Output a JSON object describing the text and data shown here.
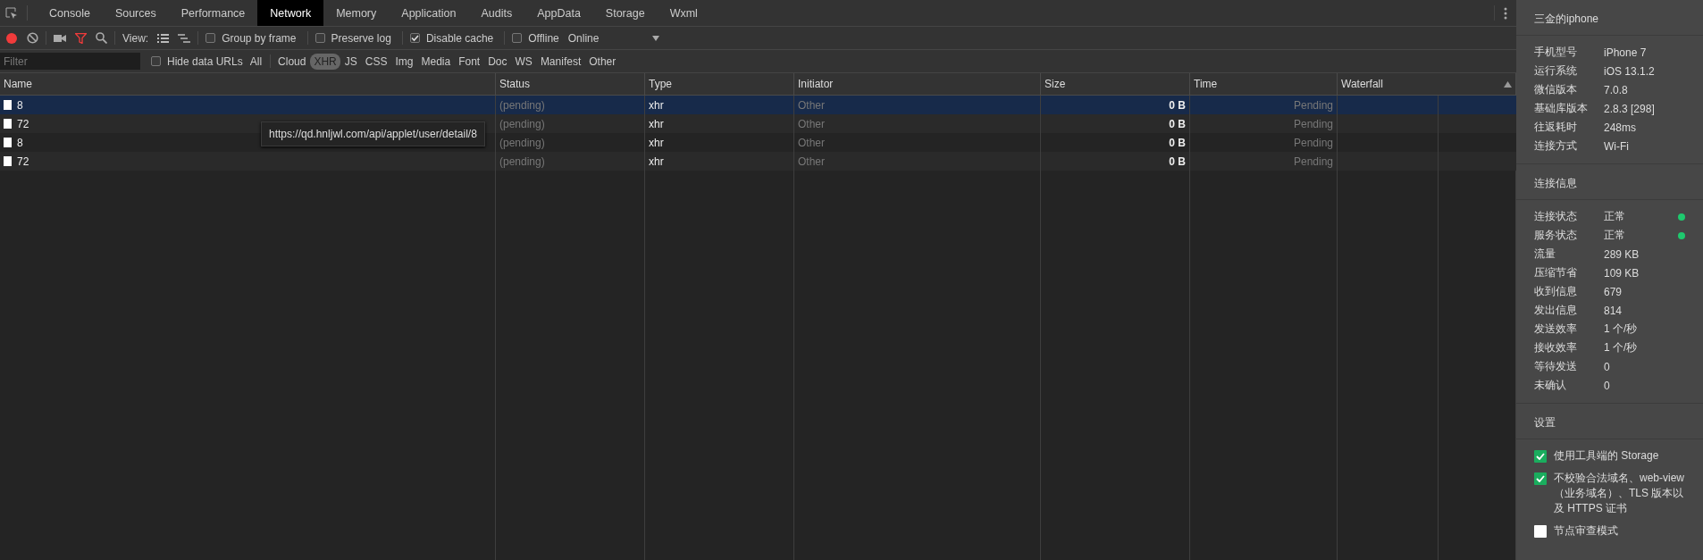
{
  "tabs": [
    {
      "label": "Console",
      "selected": false
    },
    {
      "label": "Sources",
      "selected": false
    },
    {
      "label": "Performance",
      "selected": false
    },
    {
      "label": "Network",
      "selected": true
    },
    {
      "label": "Memory",
      "selected": false
    },
    {
      "label": "Application",
      "selected": false
    },
    {
      "label": "Audits",
      "selected": false
    },
    {
      "label": "AppData",
      "selected": false
    },
    {
      "label": "Storage",
      "selected": false
    },
    {
      "label": "Wxml",
      "selected": false
    }
  ],
  "toolbar": {
    "recording": true,
    "filter_active": true,
    "view_label": "View:",
    "options": [
      {
        "label": "Group by frame",
        "checked": false
      },
      {
        "label": "Preserve log",
        "checked": false
      },
      {
        "label": "Disable cache",
        "checked": true
      },
      {
        "label": "Offline",
        "checked": false
      }
    ],
    "throttling": "Online"
  },
  "filter_bar": {
    "placeholder": "Filter",
    "hide_data_urls": {
      "label": "Hide data URLs",
      "checked": false
    },
    "types": [
      {
        "label": "All",
        "selected": false
      },
      {
        "label": "Cloud",
        "selected": false
      },
      {
        "label": "XHR",
        "selected": true
      },
      {
        "label": "JS",
        "selected": false
      },
      {
        "label": "CSS",
        "selected": false
      },
      {
        "label": "Img",
        "selected": false
      },
      {
        "label": "Media",
        "selected": false
      },
      {
        "label": "Font",
        "selected": false
      },
      {
        "label": "Doc",
        "selected": false
      },
      {
        "label": "WS",
        "selected": false
      },
      {
        "label": "Manifest",
        "selected": false
      },
      {
        "label": "Other",
        "selected": false
      }
    ]
  },
  "table": {
    "columns": [
      "Name",
      "Status",
      "Type",
      "Initiator",
      "Size",
      "Time",
      "Waterfall"
    ],
    "rows": [
      {
        "name": "8",
        "status": "(pending)",
        "type": "xhr",
        "initiator": "Other",
        "size": "0 B",
        "time": "Pending",
        "selected": true
      },
      {
        "name": "72",
        "status": "(pending)",
        "type": "xhr",
        "initiator": "Other",
        "size": "0 B",
        "time": "Pending",
        "selected": false
      },
      {
        "name": "8",
        "status": "(pending)",
        "type": "xhr",
        "initiator": "Other",
        "size": "0 B",
        "time": "Pending",
        "selected": false
      },
      {
        "name": "72",
        "status": "(pending)",
        "type": "xhr",
        "initiator": "Other",
        "size": "0 B",
        "time": "Pending",
        "selected": false
      }
    ],
    "tooltip": "https://qd.hnljwl.com/api/applet/user/detail/8"
  },
  "sidebar": {
    "device_title": "三金的iphone",
    "device_info": [
      {
        "label": "手机型号",
        "value": "iPhone 7"
      },
      {
        "label": "运行系统",
        "value": "iOS 13.1.2"
      },
      {
        "label": "微信版本",
        "value": "7.0.8"
      },
      {
        "label": "基础库版本",
        "value": "2.8.3 [298]"
      },
      {
        "label": "往返耗时",
        "value": "248ms"
      },
      {
        "label": "连接方式",
        "value": "Wi-Fi"
      }
    ],
    "connection_title": "连接信息",
    "connection_info": [
      {
        "label": "连接状态",
        "value": "正常",
        "color": "#1ec96e"
      },
      {
        "label": "服务状态",
        "value": "正常",
        "color": "#1ec96e"
      },
      {
        "label": "流量",
        "value": "289 KB"
      },
      {
        "label": "压缩节省",
        "value": "109 KB"
      },
      {
        "label": "收到信息",
        "value": "679"
      },
      {
        "label": "发出信息",
        "value": "814"
      },
      {
        "label": "发送效率",
        "value": "1 个/秒"
      },
      {
        "label": "接收效率",
        "value": "1 个/秒"
      },
      {
        "label": "等待发送",
        "value": "0"
      },
      {
        "label": "未确认",
        "value": "0"
      }
    ],
    "settings_title": "设置",
    "settings": [
      {
        "label": "使用工具端的 Storage",
        "checked": true
      },
      {
        "label": "不校验合法域名、web-view（业务域名）、TLS 版本以及 HTTPS 证书",
        "checked": true
      },
      {
        "label": "节点审查模式",
        "checked": false
      }
    ]
  }
}
